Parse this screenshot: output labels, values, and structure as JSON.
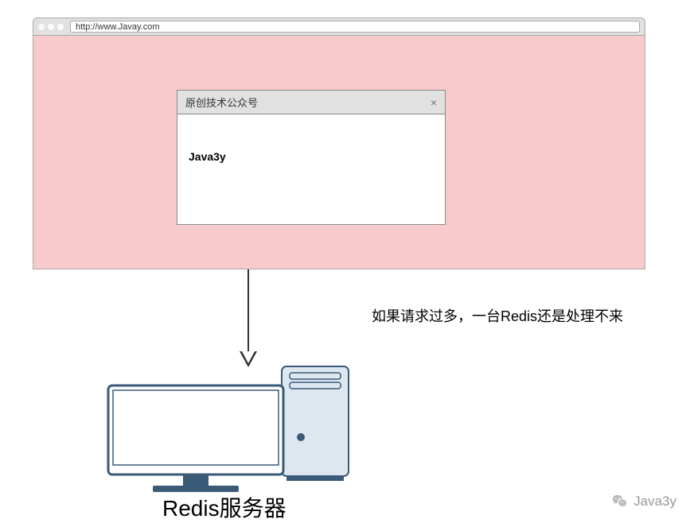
{
  "browser": {
    "url": "http://www.Javay.com"
  },
  "dialog": {
    "title": "原创技术公众号",
    "body": "Java3y"
  },
  "arrow": {
    "annotation": "如果请求过多，一台Redis还是处理不来"
  },
  "server": {
    "label": "Redis服务器"
  },
  "watermark": {
    "text": "Java3y"
  }
}
